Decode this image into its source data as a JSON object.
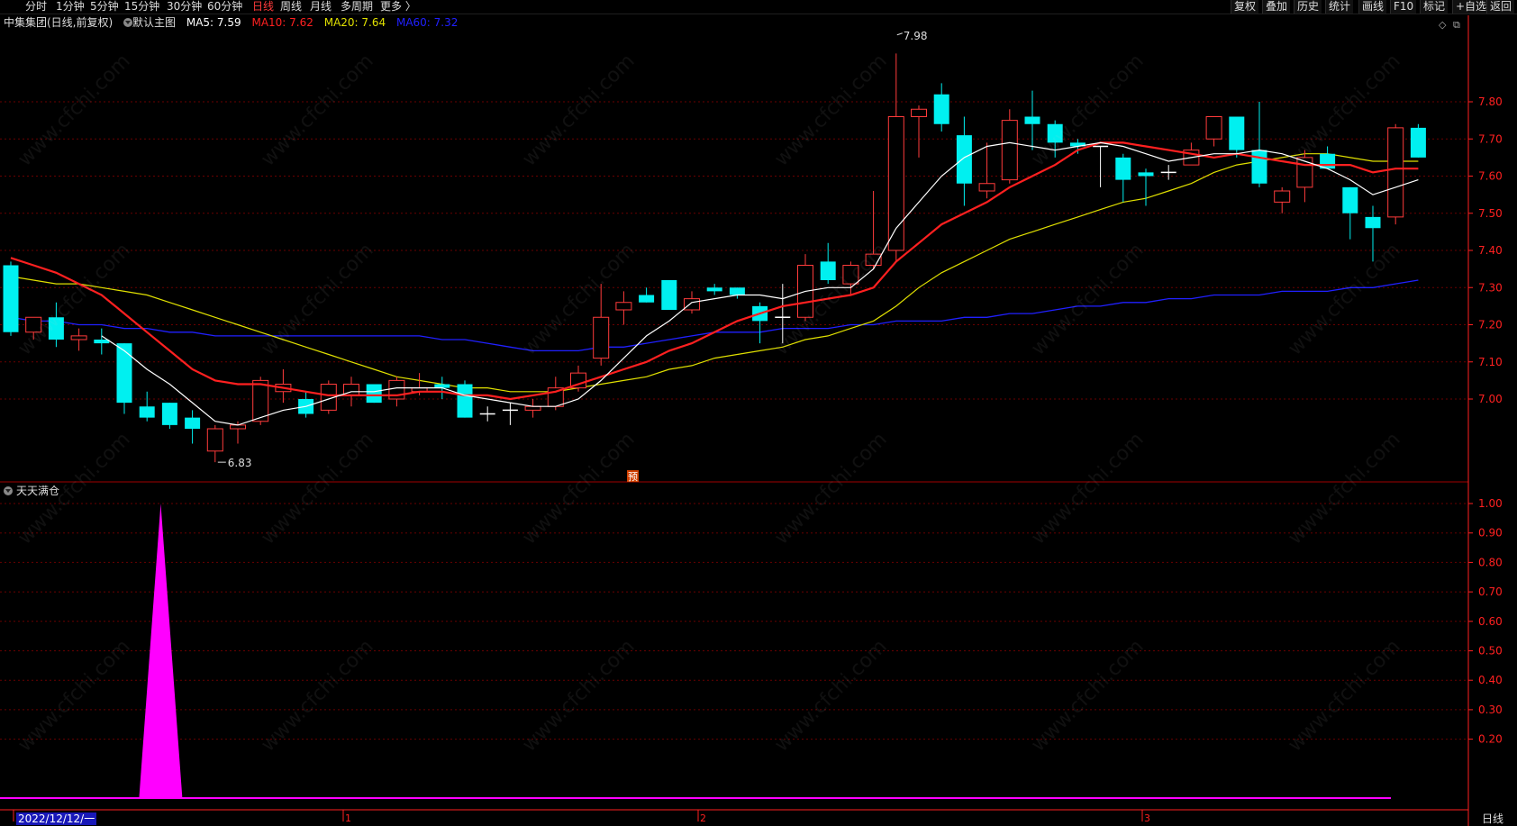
{
  "toolbar": {
    "left_items": [
      {
        "label": "分时",
        "active": false
      },
      {
        "label": "1分钟",
        "active": false
      },
      {
        "label": "5分钟",
        "active": false
      },
      {
        "label": "15分钟",
        "active": false
      },
      {
        "label": "30分钟",
        "active": false
      },
      {
        "label": "60分钟",
        "active": false
      },
      {
        "label": "日线",
        "active": true
      },
      {
        "label": "周线",
        "active": false
      },
      {
        "label": "月线",
        "active": false
      },
      {
        "label": "多周期",
        "active": false
      },
      {
        "label": "更多 〉",
        "active": false
      }
    ],
    "right_items": [
      "复权",
      "叠加",
      "历史",
      "统计",
      "画线",
      "F10",
      "标记",
      "+自选",
      "返回"
    ]
  },
  "info": {
    "stock": "中集集团(日线,前复权)",
    "template": "默认主图",
    "ma5": "MA5: 7.59",
    "ma10": "MA10: 7.62",
    "ma20": "MA20: 7.64",
    "ma60": "MA60: 7.32"
  },
  "colors": {
    "up": "#ff3b3b",
    "down": "#00f0f0",
    "ma5": "#ffffff",
    "ma10": "#ff2020",
    "ma20": "#e0e000",
    "ma60": "#2020ff",
    "indicator": "#ff00ff",
    "grid": "#6a0000",
    "axis": "#ff2020"
  },
  "annotations": {
    "high": "7.98",
    "low": "6.83",
    "pre": "预"
  },
  "indicator": {
    "name": "天天满仓",
    "axis_ticks": [
      "1.00",
      "0.90",
      "0.80",
      "0.70",
      "0.60",
      "0.50",
      "0.40",
      "0.30",
      "0.20"
    ]
  },
  "bottom": {
    "date": "2022/12/12/一",
    "month_marks": [
      "2",
      "1",
      "2",
      "3"
    ],
    "period": "日线"
  },
  "watermark": "www.cfchi.com",
  "chart_data": {
    "type": "candlestick",
    "ylim": [
      6.8,
      8.02
    ],
    "y_ticks": [
      "7.80",
      "7.70",
      "7.60",
      "7.50",
      "7.40",
      "7.30",
      "7.20",
      "7.10",
      "7.00"
    ],
    "candles": [
      [
        7.36,
        7.37,
        7.18,
        7.17
      ],
      [
        7.18,
        7.22,
        7.22,
        7.16
      ],
      [
        7.22,
        7.26,
        7.16,
        7.14
      ],
      [
        7.16,
        7.19,
        7.17,
        7.13
      ],
      [
        7.16,
        7.19,
        7.15,
        7.12
      ],
      [
        7.15,
        7.15,
        6.99,
        6.96
      ],
      [
        6.98,
        7.02,
        6.95,
        6.94
      ],
      [
        6.99,
        6.99,
        6.93,
        6.92
      ],
      [
        6.95,
        6.97,
        6.92,
        6.88
      ],
      [
        6.86,
        6.93,
        6.92,
        6.83
      ],
      [
        6.92,
        6.94,
        6.93,
        6.88
      ],
      [
        6.94,
        7.06,
        7.05,
        6.93
      ],
      [
        7.02,
        7.08,
        7.04,
        6.99
      ],
      [
        7.0,
        7.02,
        6.96,
        6.95
      ],
      [
        6.97,
        7.05,
        7.04,
        6.96
      ],
      [
        7.01,
        7.06,
        7.04,
        6.98
      ],
      [
        7.04,
        7.04,
        6.99,
        6.99
      ],
      [
        7.0,
        7.06,
        7.05,
        6.98
      ],
      [
        7.02,
        7.07,
        7.03,
        7.01
      ],
      [
        7.04,
        7.06,
        7.03,
        7.0
      ],
      [
        7.04,
        7.05,
        6.95,
        6.95
      ],
      [
        6.96,
        6.98,
        6.96,
        6.94
      ],
      [
        6.97,
        6.99,
        6.97,
        6.93
      ],
      [
        6.97,
        7.0,
        6.98,
        6.95
      ],
      [
        6.98,
        7.06,
        7.03,
        6.97
      ],
      [
        7.03,
        7.09,
        7.07,
        7.02
      ],
      [
        7.11,
        7.31,
        7.22,
        7.09
      ],
      [
        7.24,
        7.29,
        7.26,
        7.2
      ],
      [
        7.28,
        7.3,
        7.26,
        7.26
      ],
      [
        7.32,
        7.32,
        7.24,
        7.24
      ],
      [
        7.24,
        7.29,
        7.27,
        7.23
      ],
      [
        7.3,
        7.31,
        7.29,
        7.28
      ],
      [
        7.3,
        7.3,
        7.28,
        7.27
      ],
      [
        7.25,
        7.26,
        7.21,
        7.15
      ],
      [
        7.22,
        7.31,
        7.22,
        7.15
      ],
      [
        7.22,
        7.39,
        7.36,
        7.21
      ],
      [
        7.37,
        7.42,
        7.32,
        7.31
      ],
      [
        7.31,
        7.37,
        7.36,
        7.28
      ],
      [
        7.36,
        7.56,
        7.39,
        7.35
      ],
      [
        7.4,
        7.93,
        7.76,
        7.37
      ],
      [
        7.76,
        7.79,
        7.78,
        7.65
      ],
      [
        7.82,
        7.85,
        7.74,
        7.72
      ],
      [
        7.71,
        7.76,
        7.58,
        7.52
      ],
      [
        7.56,
        7.69,
        7.58,
        7.54
      ],
      [
        7.59,
        7.78,
        7.75,
        7.58
      ],
      [
        7.76,
        7.83,
        7.74,
        7.67
      ],
      [
        7.74,
        7.75,
        7.69,
        7.65
      ],
      [
        7.69,
        7.7,
        7.68,
        7.66
      ],
      [
        7.68,
        7.68,
        7.68,
        7.57
      ],
      [
        7.65,
        7.66,
        7.59,
        7.53
      ],
      [
        7.61,
        7.62,
        7.6,
        7.52
      ],
      [
        7.61,
        7.63,
        7.61,
        7.59
      ],
      [
        7.63,
        7.69,
        7.67,
        7.63
      ],
      [
        7.7,
        7.76,
        7.76,
        7.68
      ],
      [
        7.76,
        7.76,
        7.67,
        7.65
      ],
      [
        7.67,
        7.8,
        7.58,
        7.57
      ],
      [
        7.53,
        7.57,
        7.56,
        7.5
      ],
      [
        7.57,
        7.67,
        7.65,
        7.53
      ],
      [
        7.66,
        7.68,
        7.62,
        7.62
      ],
      [
        7.57,
        7.57,
        7.5,
        7.43
      ],
      [
        7.49,
        7.52,
        7.46,
        7.37
      ],
      [
        7.49,
        7.74,
        7.73,
        7.47
      ],
      [
        7.73,
        7.74,
        7.65,
        7.65
      ]
    ],
    "ma5": [
      null,
      null,
      null,
      null,
      7.17,
      7.13,
      7.08,
      7.04,
      6.99,
      6.94,
      6.93,
      6.95,
      6.97,
      6.98,
      7.0,
      7.02,
      7.02,
      7.03,
      7.03,
      7.03,
      7.01,
      7.0,
      6.99,
      6.98,
      6.98,
      7.0,
      7.05,
      7.11,
      7.17,
      7.21,
      7.26,
      7.27,
      7.28,
      7.28,
      7.27,
      7.29,
      7.3,
      7.3,
      7.35,
      7.46,
      7.53,
      7.6,
      7.65,
      7.68,
      7.69,
      7.68,
      7.67,
      7.68,
      7.69,
      7.68,
      7.66,
      7.64,
      7.65,
      7.66,
      7.66,
      7.67,
      7.66,
      7.64,
      7.62,
      7.59,
      7.55,
      7.57,
      7.59
    ],
    "ma10": [
      7.38,
      7.36,
      7.34,
      7.31,
      7.28,
      7.23,
      7.18,
      7.13,
      7.08,
      7.05,
      7.04,
      7.04,
      7.03,
      7.02,
      7.01,
      7.01,
      7.01,
      7.01,
      7.02,
      7.02,
      7.01,
      7.01,
      7.0,
      7.01,
      7.02,
      7.04,
      7.06,
      7.08,
      7.1,
      7.13,
      7.15,
      7.18,
      7.21,
      7.23,
      7.25,
      7.26,
      7.27,
      7.28,
      7.3,
      7.37,
      7.42,
      7.47,
      7.5,
      7.53,
      7.57,
      7.6,
      7.63,
      7.67,
      7.69,
      7.69,
      7.68,
      7.67,
      7.66,
      7.65,
      7.66,
      7.65,
      7.64,
      7.63,
      7.63,
      7.63,
      7.61,
      7.62,
      7.62
    ],
    "ma20": [
      7.33,
      7.32,
      7.31,
      7.31,
      7.3,
      7.29,
      7.28,
      7.26,
      7.24,
      7.22,
      7.2,
      7.18,
      7.16,
      7.14,
      7.12,
      7.1,
      7.08,
      7.06,
      7.05,
      7.04,
      7.03,
      7.03,
      7.02,
      7.02,
      7.02,
      7.03,
      7.04,
      7.05,
      7.06,
      7.08,
      7.09,
      7.11,
      7.12,
      7.13,
      7.14,
      7.16,
      7.17,
      7.19,
      7.21,
      7.25,
      7.3,
      7.34,
      7.37,
      7.4,
      7.43,
      7.45,
      7.47,
      7.49,
      7.51,
      7.53,
      7.54,
      7.56,
      7.58,
      7.61,
      7.63,
      7.64,
      7.65,
      7.66,
      7.66,
      7.65,
      7.64,
      7.64,
      7.64
    ],
    "ma60": [
      7.22,
      7.21,
      7.21,
      7.2,
      7.2,
      7.19,
      7.19,
      7.18,
      7.18,
      7.17,
      7.17,
      7.17,
      7.17,
      7.17,
      7.17,
      7.17,
      7.17,
      7.17,
      7.17,
      7.16,
      7.16,
      7.15,
      7.14,
      7.13,
      7.13,
      7.13,
      7.14,
      7.14,
      7.15,
      7.16,
      7.17,
      7.18,
      7.18,
      7.18,
      7.19,
      7.19,
      7.19,
      7.2,
      7.2,
      7.21,
      7.21,
      7.21,
      7.22,
      7.22,
      7.23,
      7.23,
      7.24,
      7.25,
      7.25,
      7.26,
      7.26,
      7.27,
      7.27,
      7.28,
      7.28,
      7.28,
      7.29,
      7.29,
      7.29,
      7.3,
      7.3,
      7.31,
      7.32
    ],
    "indicator": {
      "name": "天天满仓",
      "ylim": [
        0.0,
        1.0
      ],
      "spike_index": 7,
      "spike_value": 1.0
    }
  }
}
